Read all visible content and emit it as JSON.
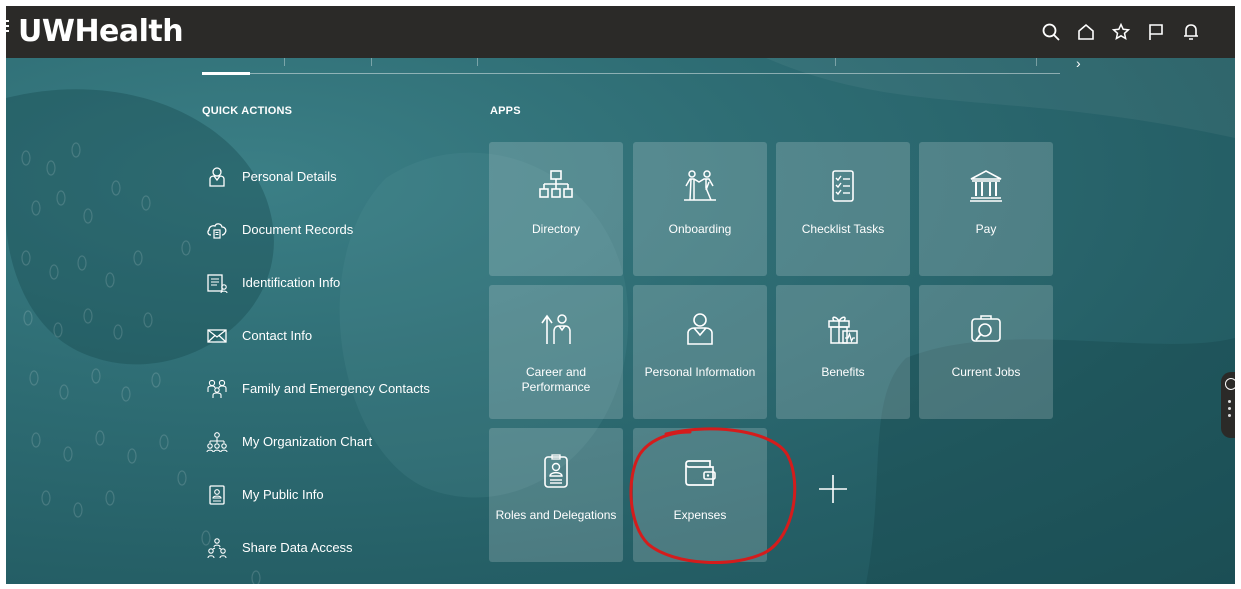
{
  "header": {
    "logo_text": "UWHealth",
    "icons": [
      "search-icon",
      "home-icon",
      "star-icon",
      "flag-icon",
      "bell-icon"
    ]
  },
  "quick_actions": {
    "title": "QUICK ACTIONS",
    "items": [
      {
        "label": "Personal Details",
        "icon": "person-icon"
      },
      {
        "label": "Document Records",
        "icon": "cloud-document-icon"
      },
      {
        "label": "Identification Info",
        "icon": "id-card-icon"
      },
      {
        "label": "Contact Info",
        "icon": "envelope-icon"
      },
      {
        "label": "Family and Emergency Contacts",
        "icon": "family-icon"
      },
      {
        "label": "My Organization Chart",
        "icon": "org-chart-icon"
      },
      {
        "label": "My Public Info",
        "icon": "badge-icon"
      },
      {
        "label": "Share Data Access",
        "icon": "share-people-icon"
      }
    ]
  },
  "apps": {
    "title": "APPS",
    "tiles": [
      {
        "label": "Directory",
        "icon": "directory-icon"
      },
      {
        "label": "Onboarding",
        "icon": "onboarding-icon"
      },
      {
        "label": "Checklist Tasks",
        "icon": "checklist-icon"
      },
      {
        "label": "Pay",
        "icon": "bank-icon"
      },
      {
        "label": "Career and Performance",
        "icon": "career-icon"
      },
      {
        "label": "Personal Information",
        "icon": "person-icon"
      },
      {
        "label": "Benefits",
        "icon": "gift-icon"
      },
      {
        "label": "Current Jobs",
        "icon": "briefcase-search-icon"
      },
      {
        "label": "Roles and Delegations",
        "icon": "badge-icon"
      },
      {
        "label": "Expenses",
        "icon": "wallet-icon"
      }
    ],
    "add_icon": "plus-icon"
  },
  "annotation_color": "#d41c1c"
}
